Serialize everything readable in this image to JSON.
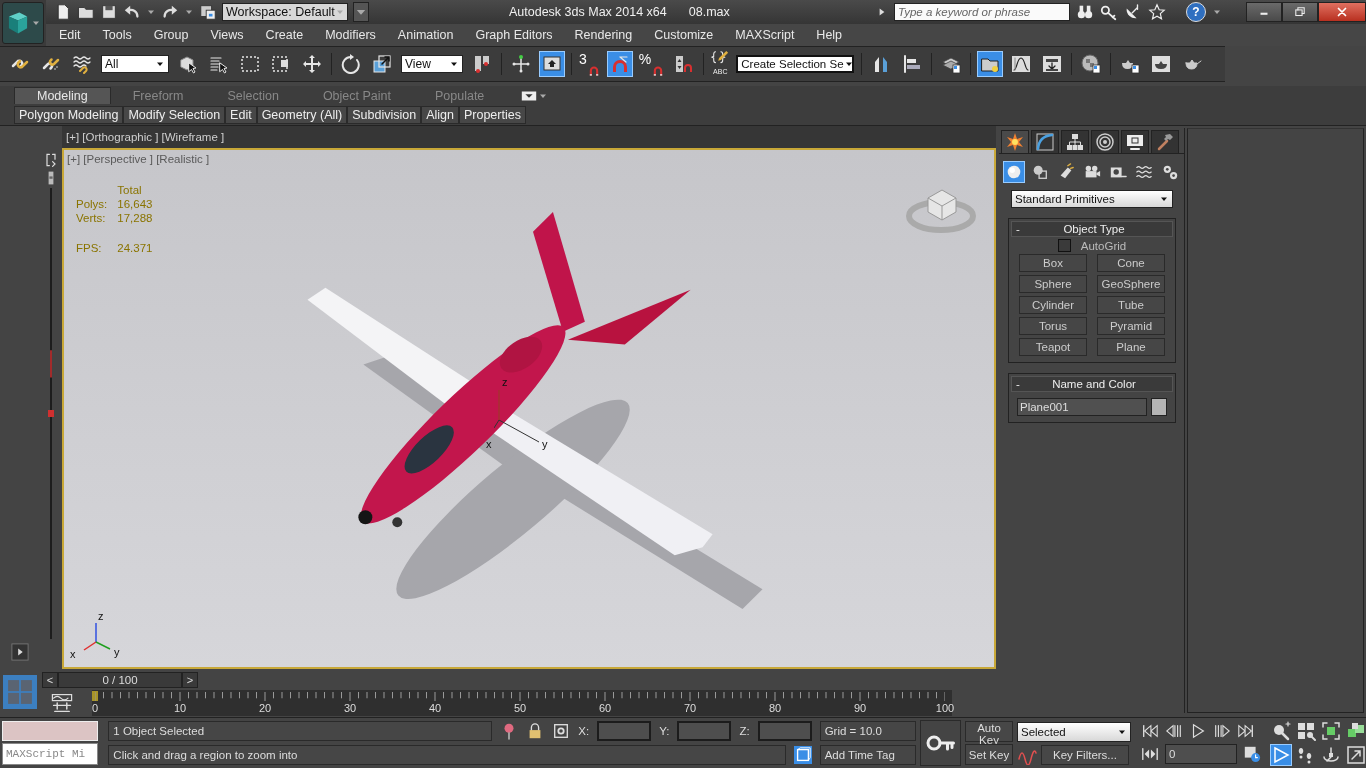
{
  "title_bar": {
    "workspace": "Workspace: Default",
    "title": "Autodesk 3ds Max  2014 x64",
    "file": "08.max",
    "search": {
      "placeholder": "Type a keyword or phrase"
    },
    "help": "?"
  },
  "menu": [
    "Edit",
    "Tools",
    "Group",
    "Views",
    "Create",
    "Modifiers",
    "Animation",
    "Graph Editors",
    "Rendering",
    "Customize",
    "MAXScript",
    "Help"
  ],
  "toolbar": {
    "selection_filter": "All",
    "reference_coordinate_system": "View",
    "snap_dimension": "3",
    "percent_sign": "%",
    "named_selection_caption": "ABC",
    "named_selection": "Create Selection Se",
    "keyboard_override_on": true,
    "angle_snap_on": true,
    "scene_explorer_on": true
  },
  "ribbon": {
    "tabs": [
      {
        "label": "Modeling",
        "selected": true
      },
      {
        "label": "Freeform",
        "selected": false
      },
      {
        "label": "Selection",
        "selected": false
      },
      {
        "label": "Object Paint",
        "selected": false
      },
      {
        "label": "Populate",
        "selected": false
      }
    ],
    "panels": [
      "Polygon Modeling",
      "Modify Selection",
      "Edit",
      "Geometry (All)",
      "Subdivision",
      "Align",
      "Properties"
    ]
  },
  "viewports": {
    "inactive_label": "[+] [Orthographic ] [Wireframe ]",
    "active_label": "[+] [Perspective ] [Realistic ]",
    "stats": {
      "header": "Total",
      "rows": [
        {
          "kind": "count",
          "label": "Polys:",
          "value": "16,643"
        },
        {
          "kind": "count",
          "label": "Verts:",
          "value": "17,288"
        },
        {
          "kind": "rate",
          "label": "FPS:",
          "value": "24.371"
        }
      ]
    },
    "gizmo_axes": [
      "z",
      "x",
      "y"
    ],
    "world_axes": [
      "z",
      "x",
      "y"
    ]
  },
  "command_panel": {
    "tabs": [
      {
        "kind": "create",
        "selected": true
      },
      {
        "kind": "modify",
        "selected": false
      },
      {
        "kind": "hierarchy",
        "selected": false
      },
      {
        "kind": "motion",
        "selected": false
      },
      {
        "kind": "display",
        "selected": false
      },
      {
        "kind": "utilities",
        "selected": false
      }
    ],
    "categories": [
      {
        "kind": "geometry",
        "selected": true
      },
      {
        "kind": "shapes",
        "selected": false
      },
      {
        "kind": "lights",
        "selected": false
      },
      {
        "kind": "cameras",
        "selected": false
      },
      {
        "kind": "helpers",
        "selected": false
      },
      {
        "kind": "space_warps",
        "selected": false
      },
      {
        "kind": "systems",
        "selected": false
      }
    ],
    "type_list": "Standard Primitives",
    "object_type": {
      "collapse": "-",
      "title": "Object Type",
      "autogrid": {
        "label": "AutoGrid",
        "checked": false
      },
      "buttons": [
        "Box",
        "Cone",
        "Sphere",
        "GeoSphere",
        "Cylinder",
        "Tube",
        "Torus",
        "Pyramid",
        "Teapot",
        "Plane"
      ]
    },
    "name_and_color": {
      "collapse": "-",
      "title": "Name and Color",
      "name": "Plane001",
      "color": "#b4b4b4"
    }
  },
  "timeline": {
    "prev": "<",
    "frame_display": "0 / 100",
    "next": ">",
    "ticks": [
      "0",
      "10",
      "20",
      "30",
      "40",
      "50",
      "60",
      "70",
      "80",
      "90",
      "100"
    ]
  },
  "status": {
    "mini_listener": "MAXScript Mi",
    "selection_info": "1 Object Selected",
    "prompt": "Click and drag a region to zoom into",
    "coords": [
      "X:",
      "Y:",
      "Z:"
    ],
    "grid": "Grid = 10.0",
    "time_tag": "Add Time Tag",
    "auto_key": "Auto Key",
    "set_key": "Set Key",
    "key_mode": "Selected",
    "key_filters": "Key Filters...",
    "current_frame": "0",
    "nav_tools": [
      {
        "kind": "zoom",
        "on": false
      },
      {
        "kind": "zoom_all",
        "on": false
      },
      {
        "kind": "zoom_extents",
        "on": false
      },
      {
        "kind": "zoom_extents_all",
        "on": false
      },
      {
        "kind": "zoom_region",
        "on": true
      },
      {
        "kind": "walk_through",
        "on": false
      },
      {
        "kind": "orbit",
        "on": false
      },
      {
        "kind": "maximize",
        "on": false
      }
    ]
  }
}
